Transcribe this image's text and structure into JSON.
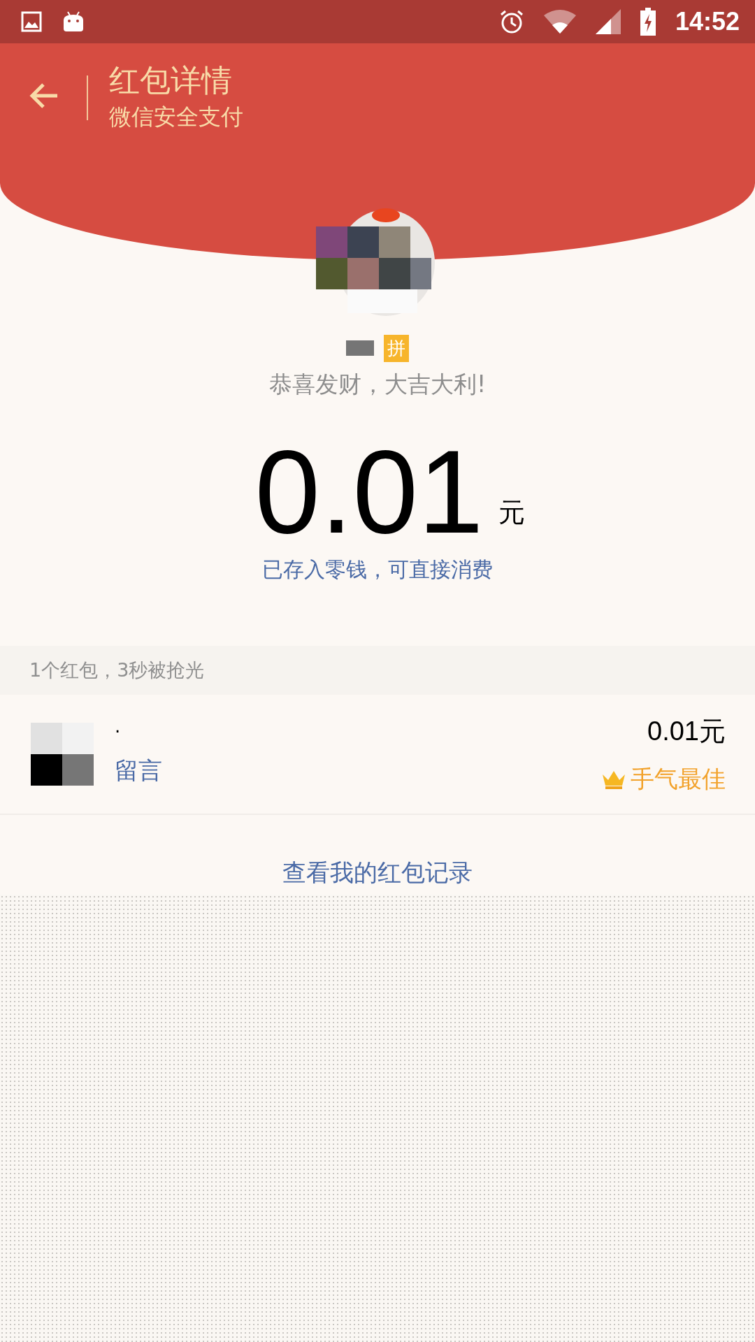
{
  "status_bar": {
    "time": "14:52"
  },
  "header": {
    "title": "红包详情",
    "subtitle": "微信安全支付"
  },
  "sender": {
    "badge": "拼",
    "greeting": "恭喜发财，大吉大利!"
  },
  "amount": {
    "value": "0.01",
    "unit": "元",
    "note": "已存入零钱，可直接消费"
  },
  "summary": "1个红包，3秒被抢光",
  "receivers": [
    {
      "name": "·",
      "action": "留言",
      "amount": "0.01元",
      "best_luck": true,
      "best_luck_label": "手气最佳"
    }
  ],
  "records_link": "查看我的红包记录"
}
